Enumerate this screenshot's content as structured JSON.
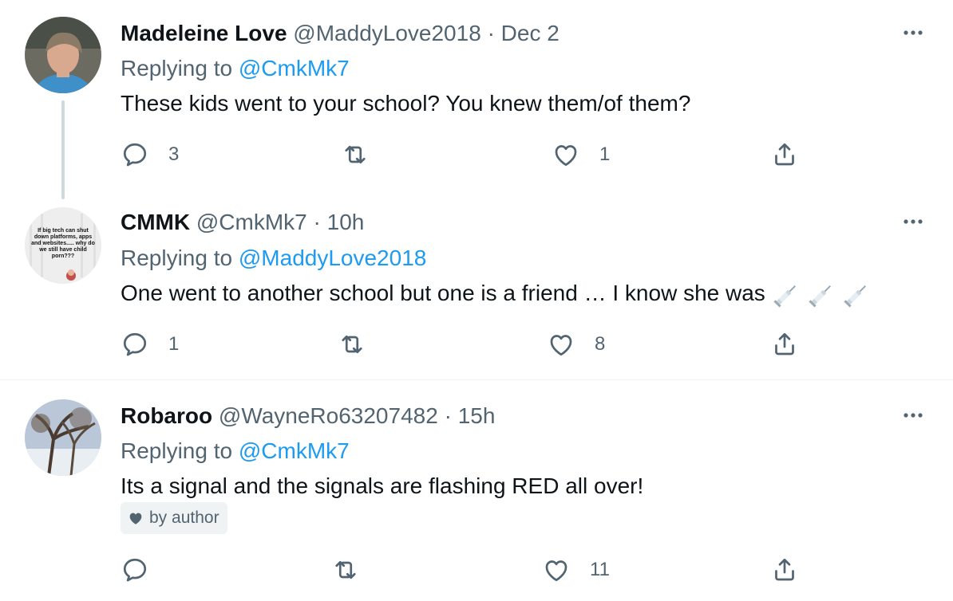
{
  "tweets": [
    {
      "name": "Madeleine Love",
      "handle": "@MaddyLove2018",
      "sep": "·",
      "time": "Dec 2",
      "replying_prefix": "Replying to",
      "replying_to": "@CmkMk7",
      "text": "These kids went to your school?  You knew them/of them?",
      "replies": "3",
      "retweets": "",
      "likes": "1"
    },
    {
      "name": "CMMK",
      "handle": "@CmkMk7",
      "sep": "·",
      "time": "10h",
      "replying_prefix": "Replying to",
      "replying_to": "@MaddyLove2018",
      "text": "One went to another school but one is a friend … I know she was",
      "emoji": "syringe-emoji",
      "avatar_text": "If big tech can shut down platforms, apps and websites..... why do we still have child porn???",
      "replies": "1",
      "retweets": "",
      "likes": "8"
    },
    {
      "name": "Robaroo",
      "handle": "@WayneRo63207482",
      "sep": "·",
      "time": "15h",
      "replying_prefix": "Replying to",
      "replying_to": "@CmkMk7",
      "text": "Its a signal and the signals are flashing RED all over!",
      "badge": "by author",
      "replies": "",
      "retweets": "",
      "likes": "11"
    }
  ],
  "colors": {
    "link": "#1d9bf0",
    "muted": "#536471",
    "text": "#0f1419"
  }
}
